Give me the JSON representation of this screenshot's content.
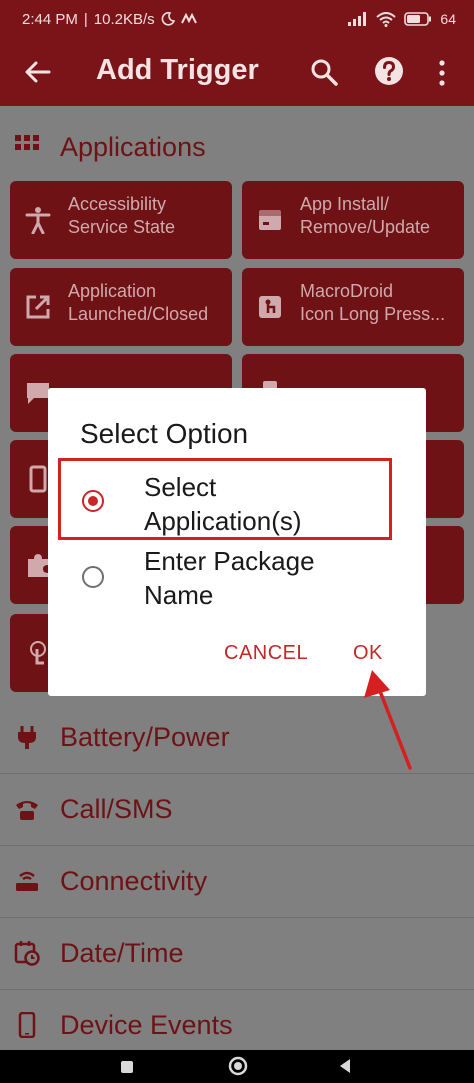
{
  "status_bar": {
    "time": "2:44 PM",
    "separator": "|",
    "speed": "10.2KB/s",
    "battery": "64"
  },
  "app_bar": {
    "title": "Add Trigger"
  },
  "sections": [
    {
      "label": "Applications",
      "icon": "grid-icon"
    },
    {
      "label": "Battery/Power",
      "icon": "plug-icon"
    },
    {
      "label": "Call/SMS",
      "icon": "phone-icon"
    },
    {
      "label": "Connectivity",
      "icon": "router-icon"
    },
    {
      "label": "Date/Time",
      "icon": "calendar-clock-icon"
    },
    {
      "label": "Device Events",
      "icon": "phone-device-icon"
    }
  ],
  "tiles": [
    {
      "label": "Accessibility\nService State",
      "icon": "accessibility-icon"
    },
    {
      "label": "App Install/\nRemove/Update",
      "icon": "app-install-icon"
    },
    {
      "label": "Application\nLaunched/Closed",
      "icon": "launch-icon"
    },
    {
      "label": "MacroDroid\nIcon Long Press...",
      "icon": "long-press-icon"
    }
  ],
  "dialog": {
    "title": "Select Option",
    "options": [
      {
        "label": "Select\nApplication(s)",
        "selected": true
      },
      {
        "label": "Enter Package\nName",
        "selected": false
      }
    ],
    "cancel_label": "CANCEL",
    "ok_label": "OK"
  },
  "colors": {
    "primary_dark": "#7a1418",
    "accent": "#c62828",
    "annotation": "#d42020"
  }
}
